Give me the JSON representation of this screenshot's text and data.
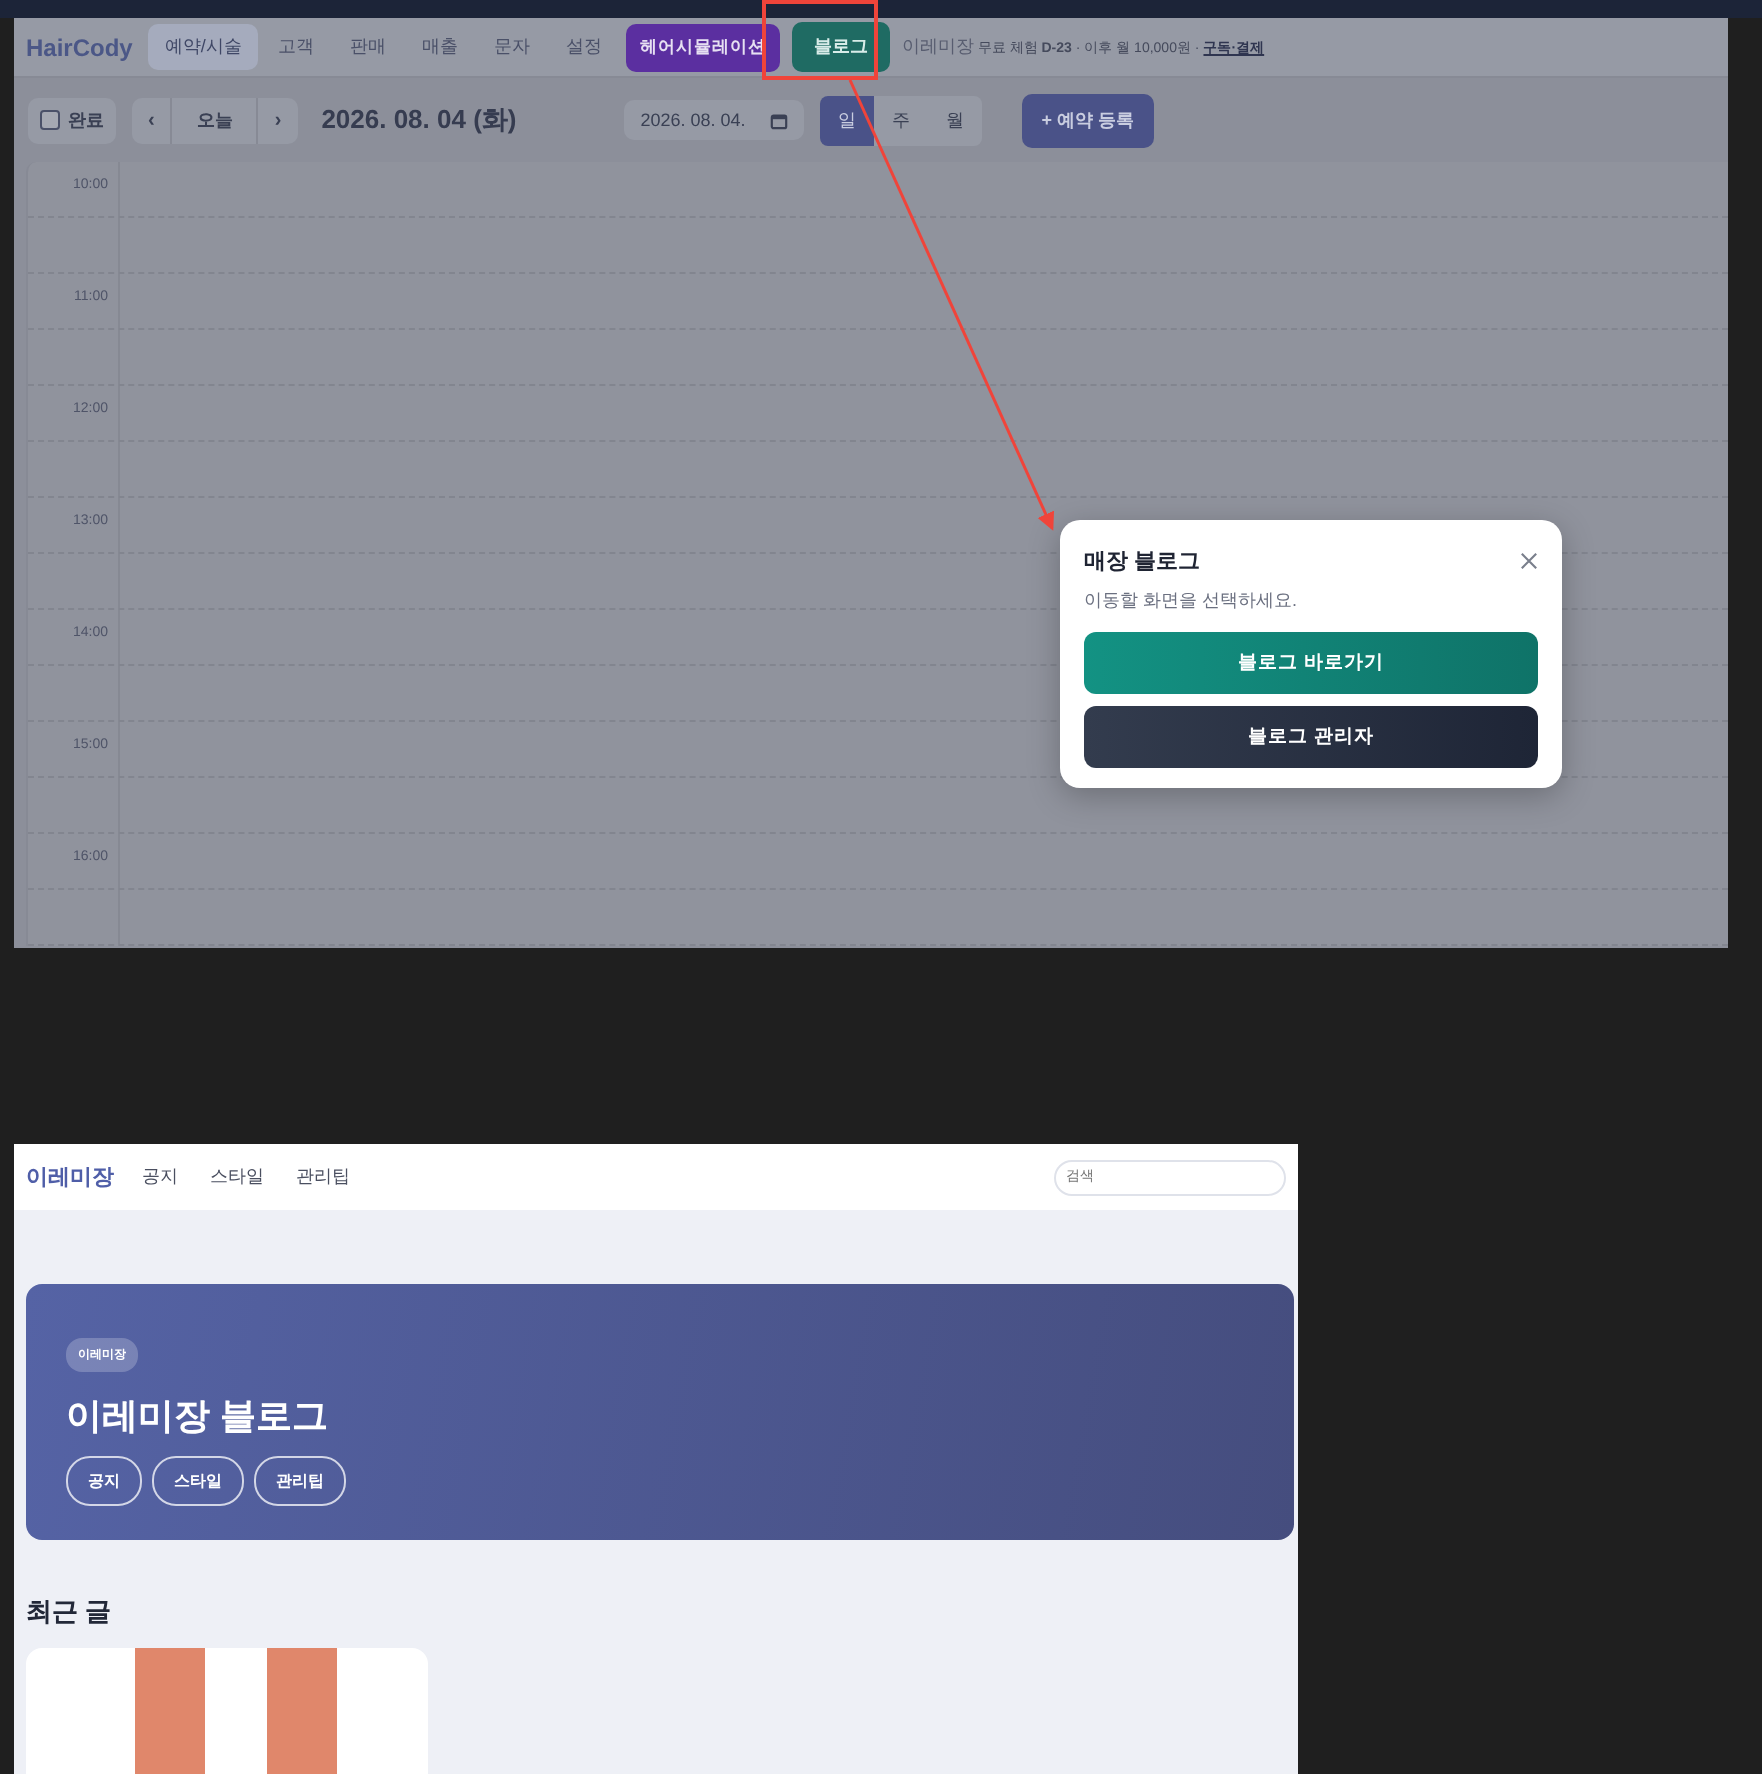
{
  "app": {
    "logo": "HairCody",
    "nav": [
      {
        "label": "예약/시술",
        "selected": true
      },
      {
        "label": "고객",
        "selected": false
      },
      {
        "label": "판매",
        "selected": false
      },
      {
        "label": "매출",
        "selected": false
      },
      {
        "label": "문자",
        "selected": false
      },
      {
        "label": "설정",
        "selected": false
      }
    ],
    "simulation_button": "헤어시뮬레이션",
    "blog_button": "블로그",
    "shop_name": "이레미장",
    "trial_text": "무료 체험 **D-23** · 이후 월 10,000원 ·",
    "subscribe_link": "구독·결제"
  },
  "toolbar": {
    "done": {
      "label": "완료",
      "checked": false
    },
    "prev": "‹",
    "today": "오늘",
    "next": "›",
    "date_title": "2026. 08. 04 (화)",
    "date_field": "2026. 08. 04.",
    "view_tabs": [
      {
        "label": "일",
        "selected": true
      },
      {
        "label": "주",
        "selected": false
      },
      {
        "label": "월",
        "selected": false
      }
    ],
    "add_button": "+ 예약 등록"
  },
  "calendar": {
    "times": [
      "10:00",
      "11:00",
      "12:00",
      "13:00",
      "14:00",
      "15:00",
      "16:00"
    ]
  },
  "dialog": {
    "title": "매장 블로그",
    "message": "이동할 화면을 선택하세요.",
    "buttons": [
      {
        "label": "블로그 바로가기",
        "kind": "primary"
      },
      {
        "label": "블로그 관리자",
        "kind": "secondary"
      }
    ]
  },
  "blog": {
    "logo": "이레미장",
    "nav": [
      "공지",
      "스타일",
      "관리팁"
    ],
    "search": {
      "placeholder": "검색"
    },
    "hero": {
      "badge": "이레미장",
      "title": "이레미장 블로그",
      "chips": [
        "공지",
        "스타일",
        "관리팁"
      ]
    },
    "recent_title": "최근 글"
  }
}
